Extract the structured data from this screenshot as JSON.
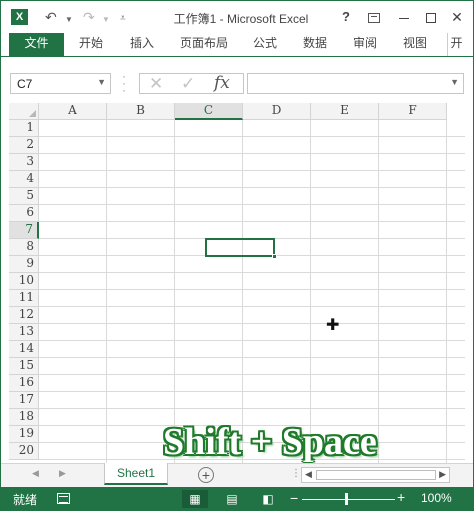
{
  "app": {
    "title": "工作簿1 - Microsoft Excel",
    "logo": "X",
    "window_buttons": {
      "help": "?"
    }
  },
  "ribbon": {
    "tabs": [
      "文件",
      "开始",
      "插入",
      "页面布局",
      "公式",
      "数据",
      "审阅",
      "视图",
      "开"
    ]
  },
  "formula_bar": {
    "name_box": "C7",
    "fx_label": "fx",
    "formula": ""
  },
  "grid": {
    "columns": [
      "A",
      "B",
      "C",
      "D",
      "E",
      "F"
    ],
    "rows": [
      "1",
      "2",
      "3",
      "4",
      "5",
      "6",
      "7",
      "8",
      "9",
      "10",
      "11",
      "12",
      "13",
      "14",
      "15",
      "16",
      "17",
      "18",
      "19",
      "20"
    ],
    "active_cell": "C7",
    "active_column": "C",
    "active_row": "7"
  },
  "overlay": {
    "text": "Shift + Space"
  },
  "sheets": {
    "tabs": [
      "Sheet1"
    ],
    "active": "Sheet1"
  },
  "status": {
    "ready": "就绪",
    "zoom": "100%"
  },
  "colors": {
    "accent": "#217346",
    "overlay_outline": "#1f7a2a"
  }
}
